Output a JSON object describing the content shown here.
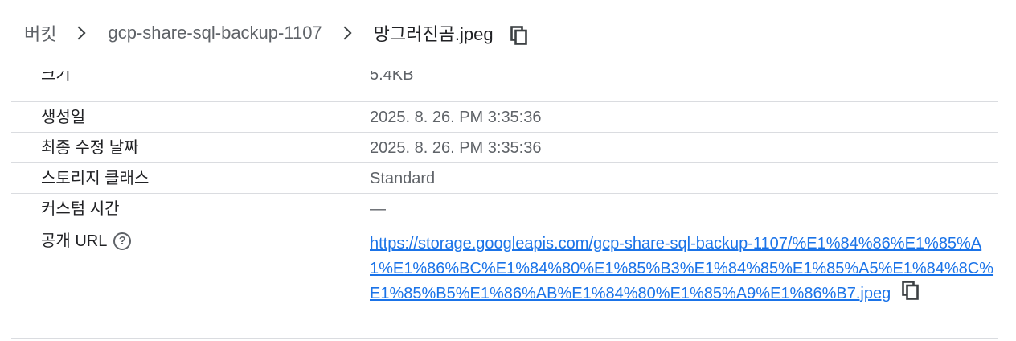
{
  "breadcrumb": {
    "root": "버킷",
    "bucket": "gcp-share-sql-backup-1107",
    "object": "망그러진곰.jpeg"
  },
  "details": {
    "size": {
      "label": "크기",
      "value": "5.4KB"
    },
    "created": {
      "label": "생성일",
      "value": "2025. 8. 26. PM 3:35:36"
    },
    "modified": {
      "label": "최종 수정 날짜",
      "value": "2025. 8. 26. PM 3:35:36"
    },
    "storage_class": {
      "label": "스토리지 클래스",
      "value": "Standard"
    },
    "custom_time": {
      "label": "커스텀 시간",
      "value": "—"
    },
    "public_url": {
      "label": "공개 URL",
      "help_icon": "?",
      "value": "https://storage.googleapis.com/gcp-share-sql-backup-1107/%E1%84%86%E1%85%A1%E1%86%BC%E1%84%80%E1%85%B3%E1%84%85%E1%85%A5%E1%84%8C%E1%85%B5%E1%86%AB%E1%84%80%E1%85%A9%E1%86%B7.jpeg"
    }
  },
  "icons": {
    "copy": "copy-icon",
    "help": "help-icon",
    "chevron": "chevron-right-icon"
  }
}
